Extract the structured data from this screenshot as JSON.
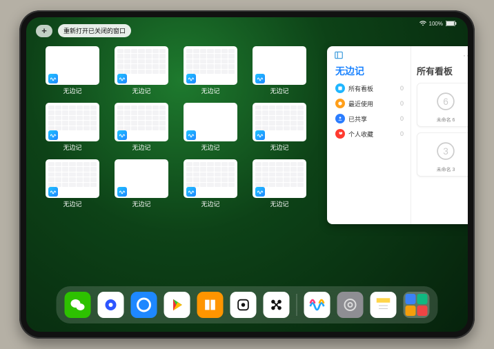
{
  "status": {
    "wifi": "wifi-icon",
    "battery": "100%"
  },
  "topbar": {
    "plus": "+",
    "reopen": "重新打开已关闭的窗口"
  },
  "app_label": "无边记",
  "thumbs": [
    {
      "type": "blank"
    },
    {
      "type": "cal"
    },
    {
      "type": "cal"
    },
    {
      "type": "blank"
    },
    {
      "type": "cal"
    },
    {
      "type": "cal"
    },
    {
      "type": "blank"
    },
    {
      "type": "cal"
    },
    {
      "type": "cal"
    },
    {
      "type": "blank"
    },
    {
      "type": "cal"
    },
    {
      "type": "cal"
    }
  ],
  "panel": {
    "title": "无边记",
    "more": "···",
    "items": [
      {
        "color": "#1fb6ff",
        "name": "所有看板",
        "count": 0
      },
      {
        "color": "#ff9f1a",
        "name": "最近使用",
        "count": 0
      },
      {
        "color": "#2b7dff",
        "name": "已共享",
        "count": 0
      },
      {
        "color": "#ff3b30",
        "name": "个人收藏",
        "count": 0
      }
    ],
    "right_title": "所有看板",
    "boards": [
      {
        "glyph": "6",
        "caption": "未命名 6"
      },
      {
        "glyph": "3",
        "caption": "未命名 3"
      }
    ]
  },
  "dock": [
    {
      "name": "wechat",
      "bg": "#2dc100",
      "fg": "#fff"
    },
    {
      "name": "quark",
      "bg": "#fff",
      "fg": "#2d55ff"
    },
    {
      "name": "qqbrowser",
      "bg": "#1e88ff",
      "fg": "#fff"
    },
    {
      "name": "play",
      "bg": "#fff",
      "fg": "#e33"
    },
    {
      "name": "books",
      "bg": "#ff9500",
      "fg": "#fff"
    },
    {
      "name": "dice",
      "bg": "#fff",
      "fg": "#111"
    },
    {
      "name": "connect",
      "bg": "#fff",
      "fg": "#111"
    }
  ],
  "recent": [
    {
      "name": "freeform",
      "bg": "#fff"
    },
    {
      "name": "settings",
      "bg": "#8e8e93"
    },
    {
      "name": "notes",
      "bg": "#fff"
    }
  ]
}
